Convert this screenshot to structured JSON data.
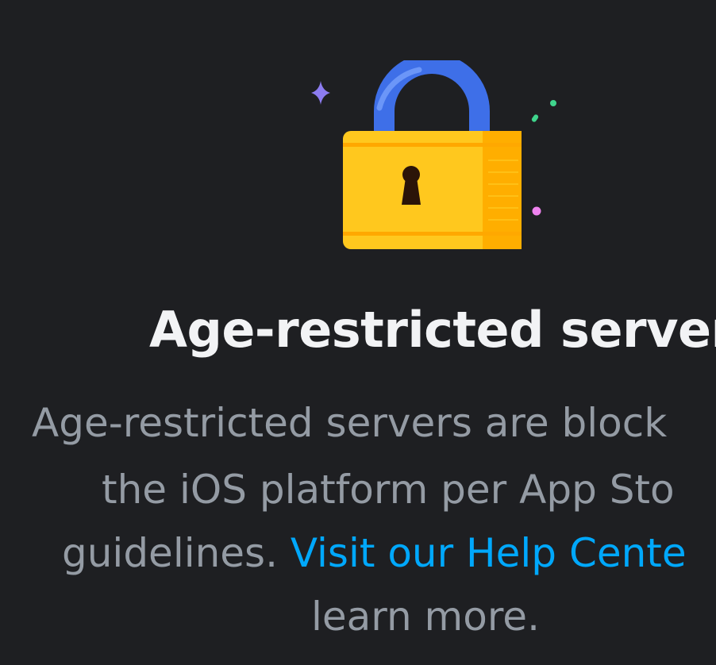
{
  "dialog": {
    "title": "Age-restricted server",
    "description": {
      "line1": "Age-restricted servers are block",
      "line2": "the iOS platform per App Sto",
      "line3_prefix": "guidelines. ",
      "link_text": "Visit our Help Cente",
      "line4": "learn more."
    }
  },
  "icons": {
    "illustration": "padlock-icon"
  },
  "colors": {
    "background": "#1e1f22",
    "title": "#f2f3f5",
    "body_text": "#949ba4",
    "link": "#00a8fc",
    "lock_body": "#ffc81e",
    "lock_shackle": "#3e6fe8"
  }
}
